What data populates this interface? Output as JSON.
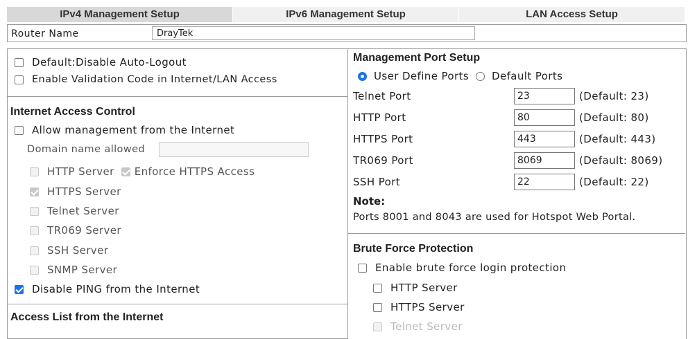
{
  "tabs": [
    {
      "label": "IPv4 Management Setup"
    },
    {
      "label": "IPv6 Management Setup"
    },
    {
      "label": "LAN Access Setup"
    }
  ],
  "router": {
    "label": "Router Name",
    "value": "DrayTek"
  },
  "left": {
    "default_logout": "Default:Disable Auto-Logout",
    "validation_code": "Enable Validation Code in Internet/LAN Access",
    "internet_access": {
      "title": "Internet Access Control",
      "allow_mgmt": "Allow management from the Internet",
      "domain_label": "Domain name allowed",
      "domain_value": "",
      "http_server": "HTTP Server",
      "enforce_https": "Enforce HTTPS Access",
      "https_server": "HTTPS Server",
      "telnet_server": "Telnet Server",
      "tr069_server": "TR069 Server",
      "ssh_server": "SSH Server",
      "snmp_server": "SNMP Server",
      "disable_ping": "Disable PING from the Internet"
    },
    "access_list_title": "Access List from the Internet"
  },
  "right": {
    "mgmt_port": {
      "title": "Management Port Setup",
      "user_define": "User Define Ports",
      "default_ports": "Default Ports",
      "ports": [
        {
          "label": "Telnet Port",
          "value": "23",
          "default": "(Default: 23)"
        },
        {
          "label": "HTTP Port",
          "value": "80",
          "default": "(Default: 80)"
        },
        {
          "label": "HTTPS Port",
          "value": "443",
          "default": "(Default: 443)"
        },
        {
          "label": "TR069 Port",
          "value": "8069",
          "default": "(Default: 8069)"
        },
        {
          "label": "SSH Port",
          "value": "22",
          "default": "(Default: 22)"
        }
      ],
      "note_title": "Note:",
      "note_text": "Ports 8001 and 8043 are used for Hotspot Web Portal."
    },
    "brute_force": {
      "title": "Brute Force Protection",
      "enable": "Enable brute force login protection",
      "http_server": "HTTP Server",
      "https_server": "HTTPS Server",
      "telnet_server": "Telnet Server"
    }
  },
  "colors": {
    "accent": "#1a73e8",
    "tab_active": "#d8d8d8",
    "tab_inactive": "#f0f0f0",
    "border": "#9a9a9a"
  }
}
